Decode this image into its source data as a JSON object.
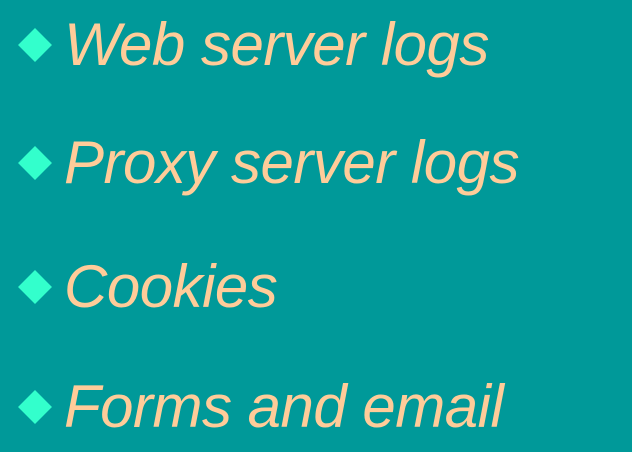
{
  "slide": {
    "background_color": "#009999",
    "text_color": "#ffcc99",
    "bullet_color": "#33ffcc",
    "bullet_icon": "diamond-icon",
    "items": [
      {
        "text": "Web server logs"
      },
      {
        "text": "Proxy server logs"
      },
      {
        "text": "Cookies"
      },
      {
        "text": "Forms and email"
      }
    ]
  }
}
